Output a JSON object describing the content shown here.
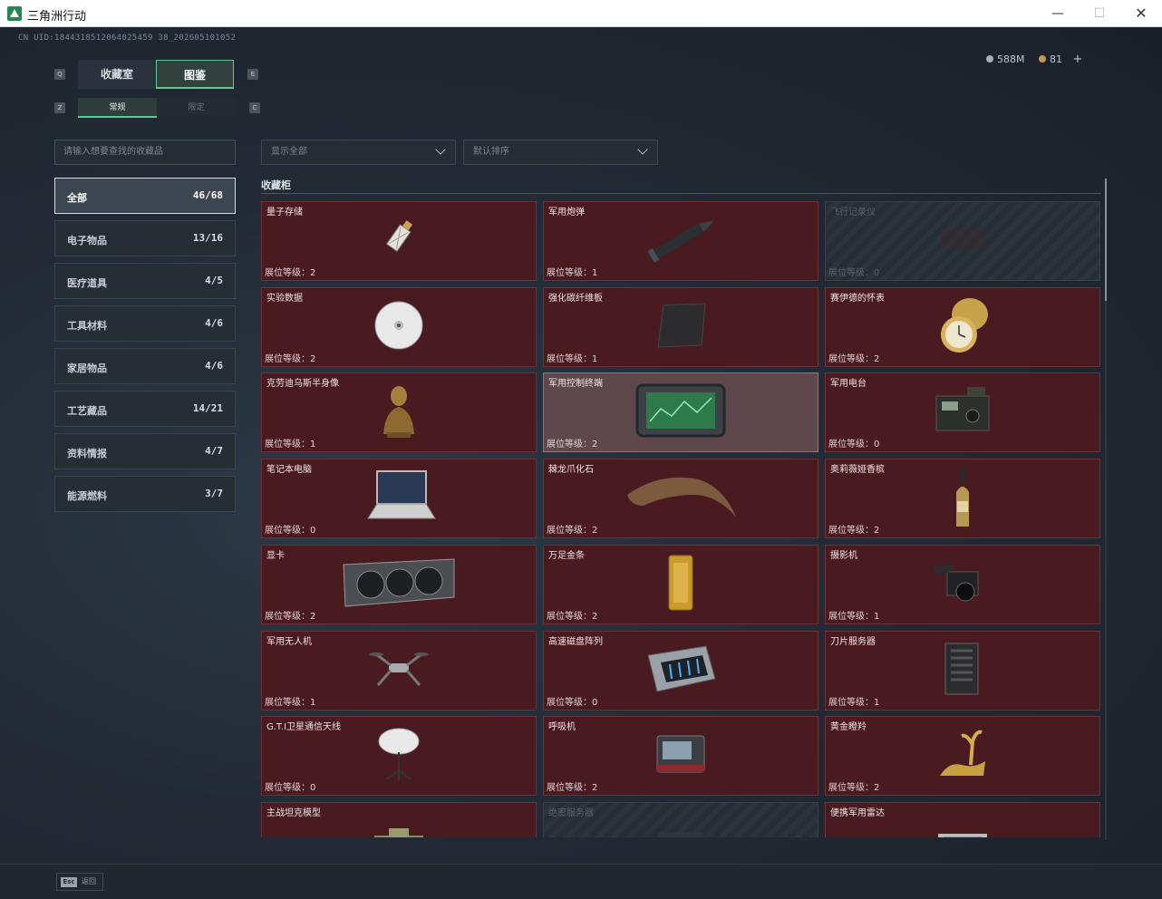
{
  "window": {
    "title": "三角洲行动",
    "minimize": "—",
    "maximize": "☐",
    "close": "✕"
  },
  "uid": "CN UID:1844318512064025459 38_202605101052",
  "currency": {
    "silver": "588M",
    "gold": "81",
    "add": "+"
  },
  "tabs": [
    {
      "label": "收藏室"
    },
    {
      "label": "图鉴"
    }
  ],
  "subtabs": [
    {
      "label": "常规"
    },
    {
      "label": "限定"
    }
  ],
  "keyhints": {
    "tab_left": "Q",
    "tab_right": "E",
    "sub_left": "Z",
    "sub_right": "C"
  },
  "search": {
    "placeholder": "请输入想要查找的收藏品"
  },
  "filters": {
    "show": "显示全部",
    "sort": "默认排序"
  },
  "section_title": "收藏柜",
  "categories": [
    {
      "label": "全部",
      "count": "46/68"
    },
    {
      "label": "电子物品",
      "count": "13/16"
    },
    {
      "label": "医疗道具",
      "count": "4/5"
    },
    {
      "label": "工具材料",
      "count": "4/6"
    },
    {
      "label": "家居物品",
      "count": "4/6"
    },
    {
      "label": "工艺藏品",
      "count": "14/21"
    },
    {
      "label": "资料情报",
      "count": "4/7"
    },
    {
      "label": "能源燃料",
      "count": "3/7"
    }
  ],
  "level_prefix": "展位等级：",
  "items": [
    {
      "name": "量子存储",
      "level": "2",
      "icon": "usb-drive-icon",
      "state": "owned"
    },
    {
      "name": "军用炮弹",
      "level": "1",
      "icon": "artillery-shell-icon",
      "state": "owned"
    },
    {
      "name": "飞行记录仪",
      "level": "0",
      "icon": "flight-recorder-icon",
      "state": "locked"
    },
    {
      "name": "实验数据",
      "level": "2",
      "icon": "disc-icon",
      "state": "owned"
    },
    {
      "name": "强化碳纤维板",
      "level": "1",
      "icon": "carbon-plate-icon",
      "state": "owned"
    },
    {
      "name": "赛伊德的怀表",
      "level": "2",
      "icon": "pocket-watch-icon",
      "state": "owned"
    },
    {
      "name": "克劳迪乌斯半身像",
      "level": "1",
      "icon": "bust-statue-icon",
      "state": "owned"
    },
    {
      "name": "军用控制终端",
      "level": "2",
      "icon": "control-terminal-icon",
      "state": "selected"
    },
    {
      "name": "军用电台",
      "level": "0",
      "icon": "military-radio-icon",
      "state": "owned"
    },
    {
      "name": "笔记本电脑",
      "level": "0",
      "icon": "laptop-icon",
      "state": "owned"
    },
    {
      "name": "棘龙爪化石",
      "level": "2",
      "icon": "claw-fossil-icon",
      "state": "owned"
    },
    {
      "name": "奥莉薇娅香槟",
      "level": "2",
      "icon": "champagne-bottle-icon",
      "state": "owned"
    },
    {
      "name": "显卡",
      "level": "2",
      "icon": "graphics-card-icon",
      "state": "owned"
    },
    {
      "name": "万足金条",
      "level": "2",
      "icon": "gold-bar-icon",
      "state": "owned"
    },
    {
      "name": "摄影机",
      "level": "1",
      "icon": "camera-icon",
      "state": "owned"
    },
    {
      "name": "军用无人机",
      "level": "1",
      "icon": "drone-icon",
      "state": "owned"
    },
    {
      "name": "高速磁盘阵列",
      "level": "0",
      "icon": "disk-array-icon",
      "state": "owned"
    },
    {
      "name": "刀片服务器",
      "level": "1",
      "icon": "blade-server-icon",
      "state": "owned"
    },
    {
      "name": "G.T.I卫星通信天线",
      "level": "0",
      "icon": "satellite-dish-icon",
      "state": "owned"
    },
    {
      "name": "呼吸机",
      "level": "2",
      "icon": "ventilator-icon",
      "state": "owned"
    },
    {
      "name": "黄金瞪羚",
      "level": "2",
      "icon": "golden-gazelle-icon",
      "state": "owned"
    },
    {
      "name": "主战坦克模型",
      "level": "",
      "icon": "tank-model-icon",
      "state": "owned"
    },
    {
      "name": "绝密服务器",
      "level": "",
      "icon": "server-icon",
      "state": "locked"
    },
    {
      "name": "便携军用雷达",
      "level": "",
      "icon": "portable-radar-icon",
      "state": "owned"
    }
  ],
  "bottom": {
    "esc_key": "Esc",
    "esc_label": "返回"
  }
}
